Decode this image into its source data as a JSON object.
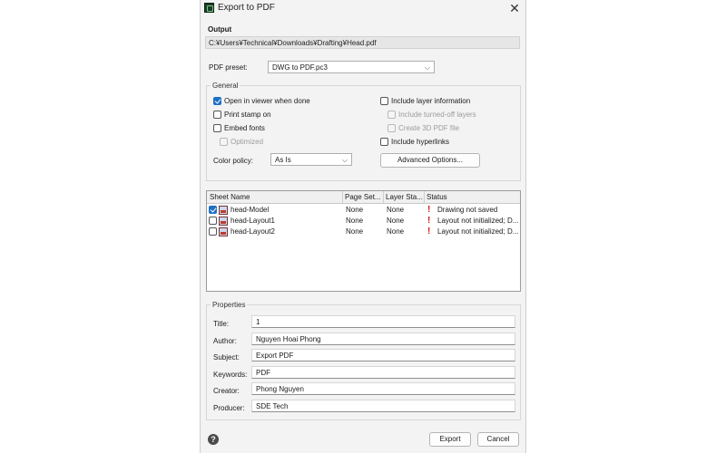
{
  "window": {
    "title": "Export to PDF",
    "close_glyph": "✕"
  },
  "output": {
    "label": "Output",
    "path": "C:¥Users¥Technical¥Downloads¥Drafting¥Head.pdf"
  },
  "preset": {
    "label": "PDF preset:",
    "value": "DWG to PDF.pc3"
  },
  "general": {
    "title": "General",
    "open_in_viewer": {
      "label": "Open in viewer when done",
      "checked": true
    },
    "print_stamp": {
      "label": "Print stamp on",
      "checked": false
    },
    "embed_fonts": {
      "label": "Embed fonts",
      "checked": false
    },
    "optimized": {
      "label": "Optimized",
      "checked": false,
      "disabled": true
    },
    "include_layer_info": {
      "label": "Include layer information",
      "checked": false
    },
    "include_turned_off": {
      "label": "Include turned-off layers",
      "checked": false,
      "disabled": true
    },
    "create_3d_pdf": {
      "label": "Create 3D PDF file",
      "checked": false,
      "disabled": true
    },
    "include_hyperlinks": {
      "label": "Include hyperlinks",
      "checked": false
    },
    "color_policy": {
      "label": "Color policy:",
      "value": "As Is"
    },
    "advanced_button": "Advanced Options..."
  },
  "sheets": {
    "columns": [
      "Sheet Name",
      "Page Set...",
      "Layer Sta...",
      "Status"
    ],
    "rows": [
      {
        "checked": true,
        "name": "head-Model",
        "page_setup": "None",
        "layer_state": "None",
        "status": "Drawing not saved"
      },
      {
        "checked": false,
        "name": "head-Layout1",
        "page_setup": "None",
        "layer_state": "None",
        "status": "Layout not initialized; D..."
      },
      {
        "checked": false,
        "name": "head-Layout2",
        "page_setup": "None",
        "layer_state": "None",
        "status": "Layout not initialized; D..."
      }
    ]
  },
  "properties": {
    "title": "Properties",
    "fields": [
      {
        "label": "Title:",
        "value": "1"
      },
      {
        "label": "Author:",
        "value": "Nguyen Hoai Phong"
      },
      {
        "label": "Subject:",
        "value": "Export PDF"
      },
      {
        "label": "Keywords:",
        "value": "PDF"
      },
      {
        "label": "Creator:",
        "value": "Phong Nguyen"
      },
      {
        "label": "Producer:",
        "value": "SDE Tech"
      }
    ]
  },
  "footer": {
    "help_glyph": "?",
    "export_label": "Export",
    "cancel_label": "Cancel"
  },
  "colors": {
    "accent": "#1f6fc4",
    "warning": "#d11a1a"
  }
}
